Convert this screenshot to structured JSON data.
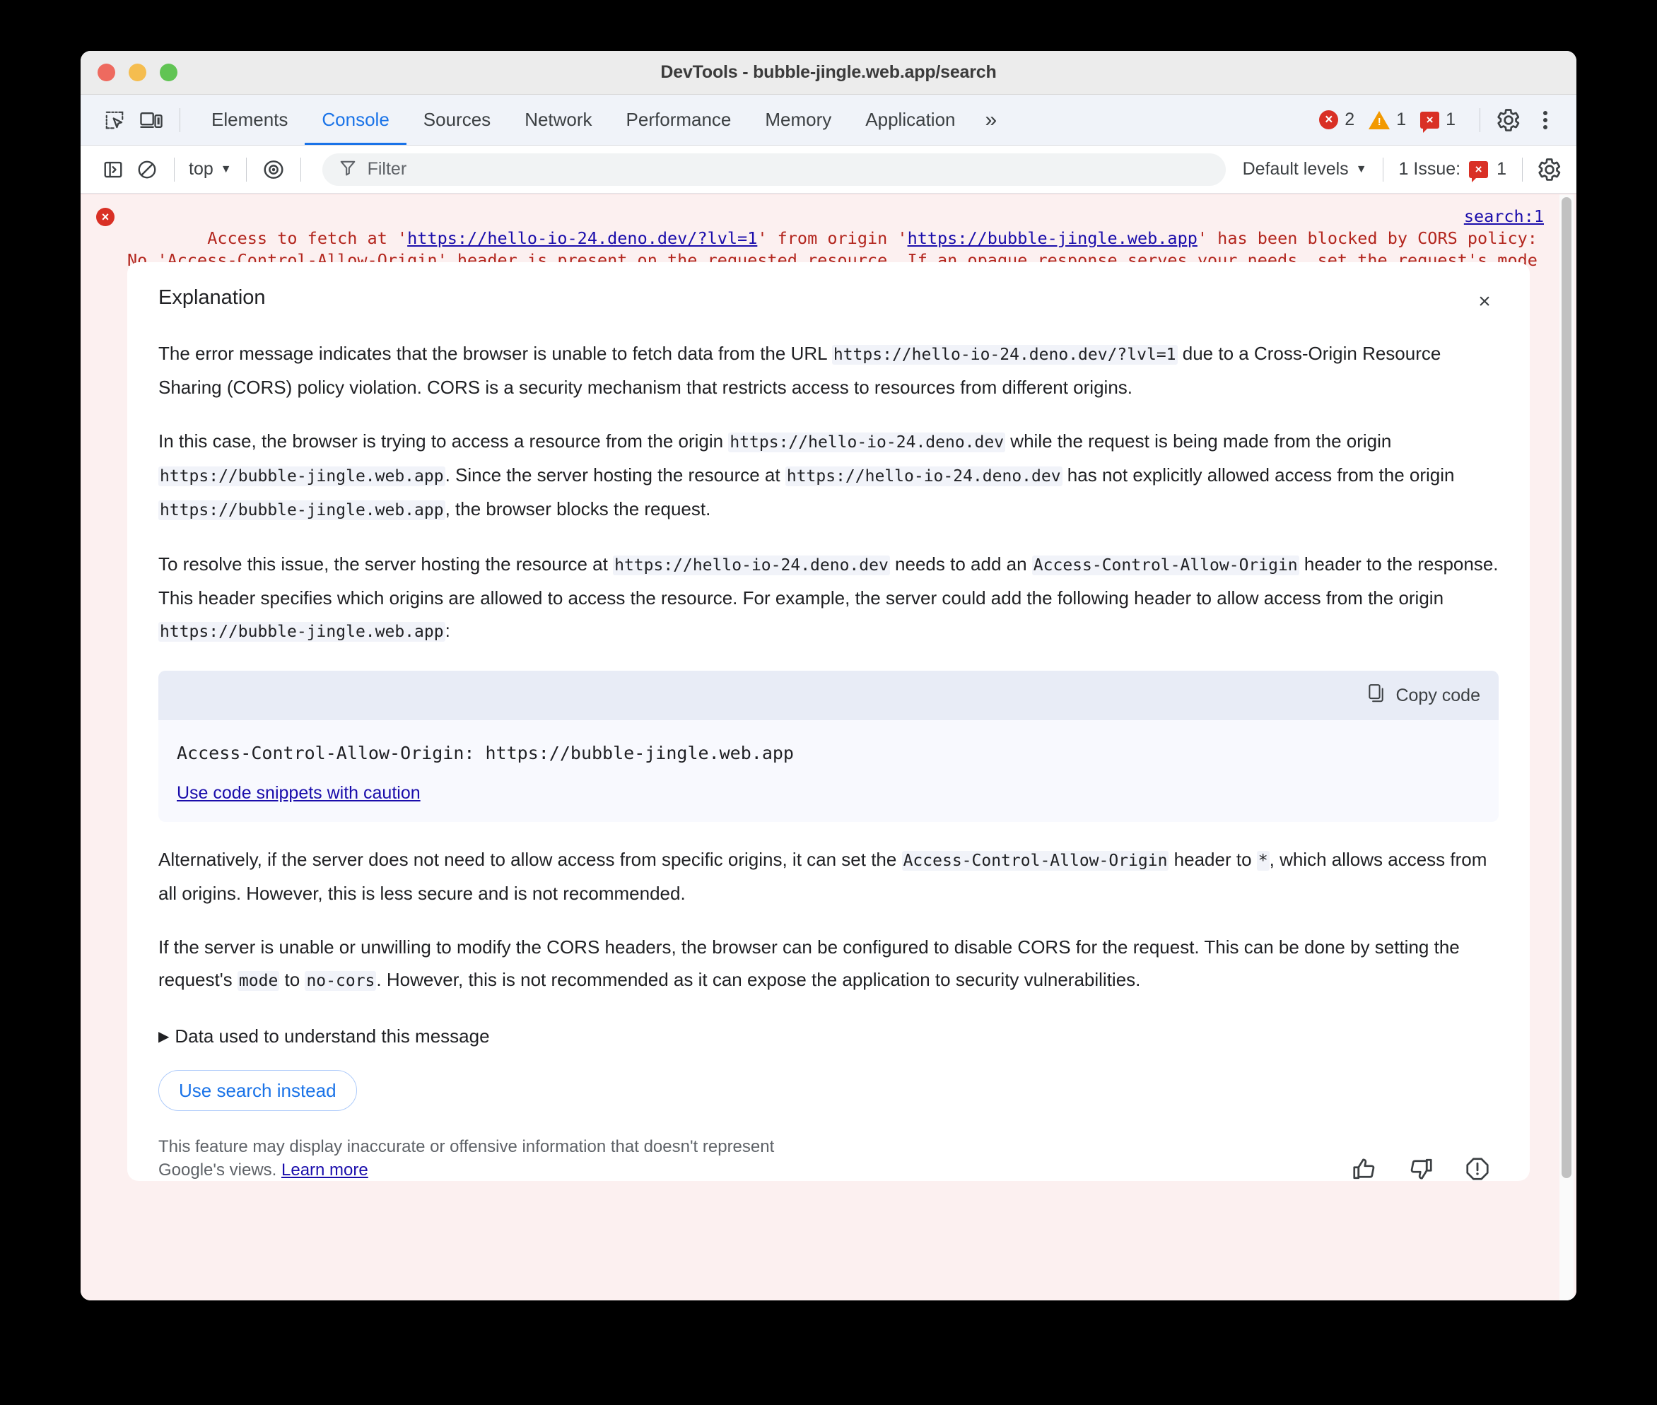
{
  "window": {
    "title": "DevTools - bubble-jingle.web.app/search",
    "traffic_lights": [
      "close",
      "minimize",
      "zoom"
    ]
  },
  "tabstrip": {
    "inspect_icon": "inspect-element-icon",
    "device_icon": "device-toolbar-icon",
    "tabs": [
      {
        "label": "Elements",
        "active": false
      },
      {
        "label": "Console",
        "active": true
      },
      {
        "label": "Sources",
        "active": false
      },
      {
        "label": "Network",
        "active": false
      },
      {
        "label": "Performance",
        "active": false
      },
      {
        "label": "Memory",
        "active": false
      },
      {
        "label": "Application",
        "active": false
      }
    ],
    "more_tabs": "»",
    "counters": {
      "errors": "2",
      "warnings": "1",
      "issues": "1",
      "error_glyph": "×",
      "warning_glyph": "!",
      "issue_glyph": "×"
    },
    "settings_icon": "gear-icon",
    "menu_icon": "kebab-menu-icon"
  },
  "console_toolbar": {
    "sidebar_icon": "console-sidebar-icon",
    "clear_icon": "clear-console-icon",
    "context": "top",
    "context_caret": "▼",
    "eye_icon": "live-expression-icon",
    "filter_icon": "filter-icon",
    "filter_value": "",
    "filter_placeholder": "Filter",
    "levels": "Default levels",
    "levels_caret": "▼",
    "issues_label": "1 Issue:",
    "issues_count": "1",
    "issue_glyph": "×",
    "settings_icon": "gear-icon"
  },
  "console_message": {
    "error_glyph": "×",
    "prefix": "Access to fetch at '",
    "url": "https://hello-io-24.deno.dev/?lvl=1",
    "mid": "' from origin '",
    "origin": "https://bubble-jingle.web.app",
    "suffix": "' has been blocked by CORS policy: No 'Access-Control-Allow-Origin' header is present on the requested resource. If an opaque response serves your needs, set the request's mode to 'no-cors' to fetch the resource with CORS disabled.",
    "source_link": "search:1"
  },
  "explanation": {
    "title": "Explanation",
    "close_glyph": "×",
    "p1": {
      "a": "The error message indicates that the browser is unable to fetch data from the URL ",
      "code1": "https://hello-io-24.deno.dev/?lvl=1",
      "b": " due to a Cross-Origin Resource Sharing (CORS) policy violation. CORS is a security mechanism that restricts access to resources from different origins."
    },
    "p2": {
      "a": "In this case, the browser is trying to access a resource from the origin ",
      "code1": "https://hello-io-24.deno.dev",
      "b": " while the request is being made from the origin ",
      "code2": "https://bubble-jingle.web.app",
      "c": ". Since the server hosting the resource at ",
      "code3": "https://hello-io-24.deno.dev",
      "d": " has not explicitly allowed access from the origin ",
      "code4": "https://bubble-jingle.web.app",
      "e": ", the browser blocks the request."
    },
    "p3": {
      "a": "To resolve this issue, the server hosting the resource at ",
      "code1": "https://hello-io-24.deno.dev",
      "b": " needs to add an ",
      "code2": "Access-Control-Allow-Origin",
      "c": " header to the response. This header specifies which origins are allowed to access the resource. For example, the server could add the following header to allow access from the origin ",
      "code3": "https://bubble-jingle.web.app",
      "d": ":"
    },
    "code_block": {
      "copy_label": "Copy code",
      "copy_icon": "copy-icon",
      "code": "Access-Control-Allow-Origin: https://bubble-jingle.web.app",
      "caution_link": "Use code snippets with caution"
    },
    "p4": {
      "a": "Alternatively, if the server does not need to allow access from specific origins, it can set the ",
      "code1": "Access-Control-Allow-Origin",
      "b": " header to ",
      "code2": "*",
      "c": ", which allows access from all origins. However, this is less secure and is not recommended."
    },
    "p5": {
      "a": "If the server is unable or unwilling to modify the CORS headers, the browser can be configured to disable CORS for the request. This can be done by setting the request's ",
      "code1": "mode",
      "b": " to ",
      "code2": "no-cors",
      "c": ". However, this is not recommended as it can expose the application to security vulnerabilities."
    },
    "disclosure": {
      "triangle": "▶",
      "label": "Data used to understand this message"
    },
    "use_search_button": "Use search instead",
    "disclaimer": {
      "text": "This feature may display inaccurate or offensive information that doesn't represent Google's views. ",
      "link": "Learn more"
    },
    "feedback": {
      "thumbs_up_icon": "thumb-up-icon",
      "thumbs_down_icon": "thumb-down-icon",
      "report_icon": "report-icon"
    }
  },
  "colors": {
    "accent": "#1a73e8",
    "error": "#d93025",
    "warning": "#f29900",
    "link": "#1a0dab",
    "error_bg": "#fcf0f0",
    "code_bg": "#f1f3f9"
  }
}
